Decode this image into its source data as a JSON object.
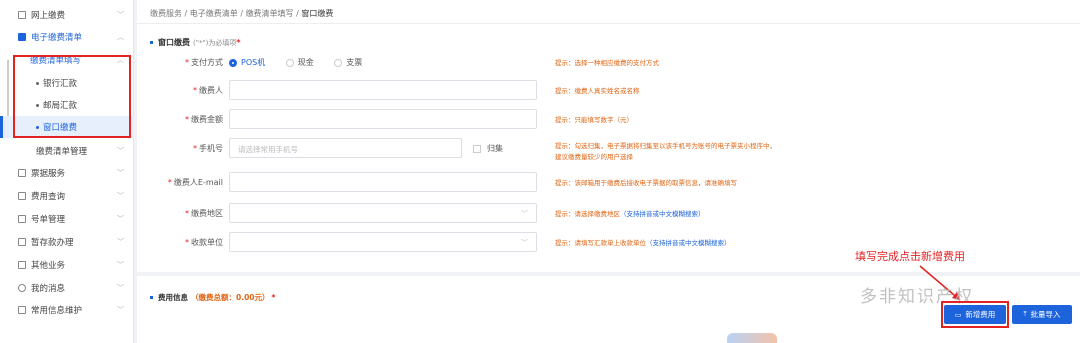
{
  "sidebar": {
    "items": [
      {
        "label": "网上缴费"
      },
      {
        "label": "电子缴费清单"
      },
      {
        "label": "缴费清单填写"
      },
      {
        "label": "银行汇款"
      },
      {
        "label": "邮局汇款"
      },
      {
        "label": "窗口缴费"
      },
      {
        "label": "缴费清单管理"
      },
      {
        "label": "票据服务"
      },
      {
        "label": "费用查询"
      },
      {
        "label": "号单管理"
      },
      {
        "label": "暂存款办理"
      },
      {
        "label": "其他业务"
      },
      {
        "label": "我的消息"
      },
      {
        "label": "常用信息维护"
      }
    ]
  },
  "breadcrumb": [
    "缴费服务",
    "电子缴费清单",
    "缴费清单填写",
    "窗口缴费"
  ],
  "section": {
    "title": "窗口缴费",
    "note": "(\"*\")为必填项",
    "star": "*"
  },
  "form": {
    "pay_method": {
      "label": "支付方式",
      "options": [
        "POS机",
        "现金",
        "支票"
      ],
      "selected": "POS机",
      "hint": "提示：选择一种相应缴费的支付方式"
    },
    "payer": {
      "label": "缴费人",
      "hint": "提示：缴费人真实姓名或名称"
    },
    "amount": {
      "label": "缴费金额",
      "hint": "提示：只能填写数字（元）"
    },
    "phone": {
      "label": "手机号",
      "placeholder": "请选择常用手机号",
      "checkbox": "归集",
      "hint1": "提示：勾选归集，电子票据将归集至以该手机号为账号的电子票夹小程序中，",
      "hint2": "建议缴费量较少的用户选择"
    },
    "email": {
      "label": "缴费人E-mail",
      "hint": "提示：该邮箱用于缴费后接收电子票据的取票信息，请准确填写"
    },
    "region": {
      "label": "缴费地区",
      "hint": "提示：请选择缴费地区",
      "hint_blue": "（支持拼音或中文模糊搜索）"
    },
    "unit": {
      "label": "收款单位",
      "hint": "提示：请填写汇款单上收款单位",
      "hint_blue": "（支持拼音或中文模糊搜索）"
    }
  },
  "fee": {
    "title": "费用信息",
    "total": "（缴费总额：0.00元）",
    "star": "*",
    "add_button": "新增费用",
    "import_button": "批量导入"
  },
  "annotation": "填写完成点击新增费用",
  "watermark": "多非知识产权",
  "colors": {
    "accent": "#1d63dc",
    "annotation": "#e32222",
    "hint": "#e06412"
  }
}
